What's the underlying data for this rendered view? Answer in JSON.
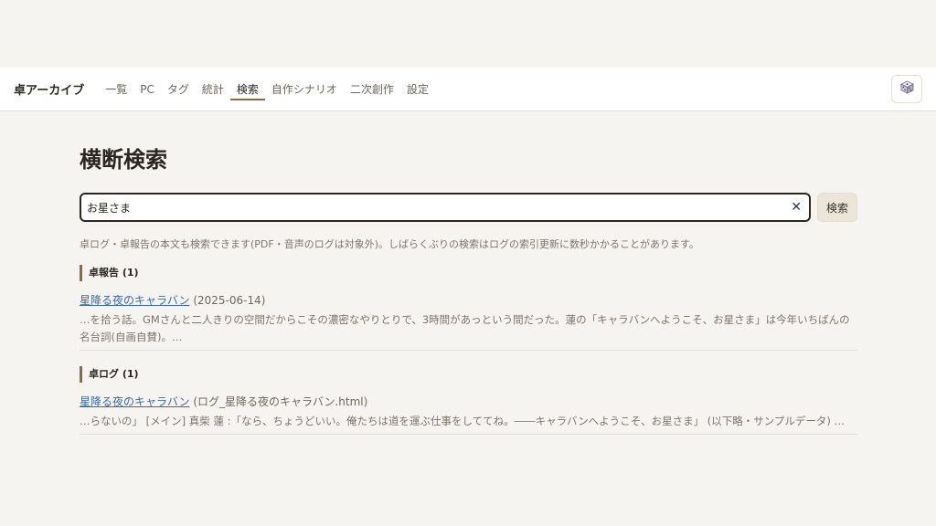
{
  "header": {
    "brand": "卓アーカイブ",
    "nav": [
      "一覧",
      "PC",
      "タグ",
      "統計",
      "検索",
      "自作シナリオ",
      "二次創作",
      "設定"
    ],
    "active_nav": "検索",
    "dice_icon": "dice-icon"
  },
  "main": {
    "title": "横断検索",
    "search": {
      "value": "お星さま",
      "placeholder": "",
      "clear_glyph": "✕",
      "button_label": "検索"
    },
    "note": "卓ログ・卓報告の本文も検索できます(PDF・音声のログは対象外)。しばらくぶりの検索はログの索引更新に数秒かかることがあります。",
    "sections": [
      {
        "heading": "卓報告 (1)",
        "result": {
          "title": "星降る夜のキャラバン",
          "meta": "(2025-06-14)",
          "snippet": "…を拾う話。GMさんと二人きりの空間だからこその濃密なやりとりで、3時間があっという間だった。蓮の「キャラバンへようこそ、お星さま」は今年いちばんの名台詞(自画自賛)。…"
        }
      },
      {
        "heading": "卓ログ (1)",
        "result": {
          "title": "星降る夜のキャラバン",
          "meta": "(ログ_星降る夜のキャラバン.html)",
          "snippet": "…らないの」 [メイン] 真柴 蓮 :「なら、ちょうどいい。俺たちは道を運ぶ仕事をしててね。――キャラバンへようこそ、お星さま」 (以下略・サンプルデータ) …"
        }
      }
    ]
  },
  "colors": {
    "background": "#f6f4f0",
    "accent": "#8b6a46",
    "link": "#3a6aa8"
  }
}
